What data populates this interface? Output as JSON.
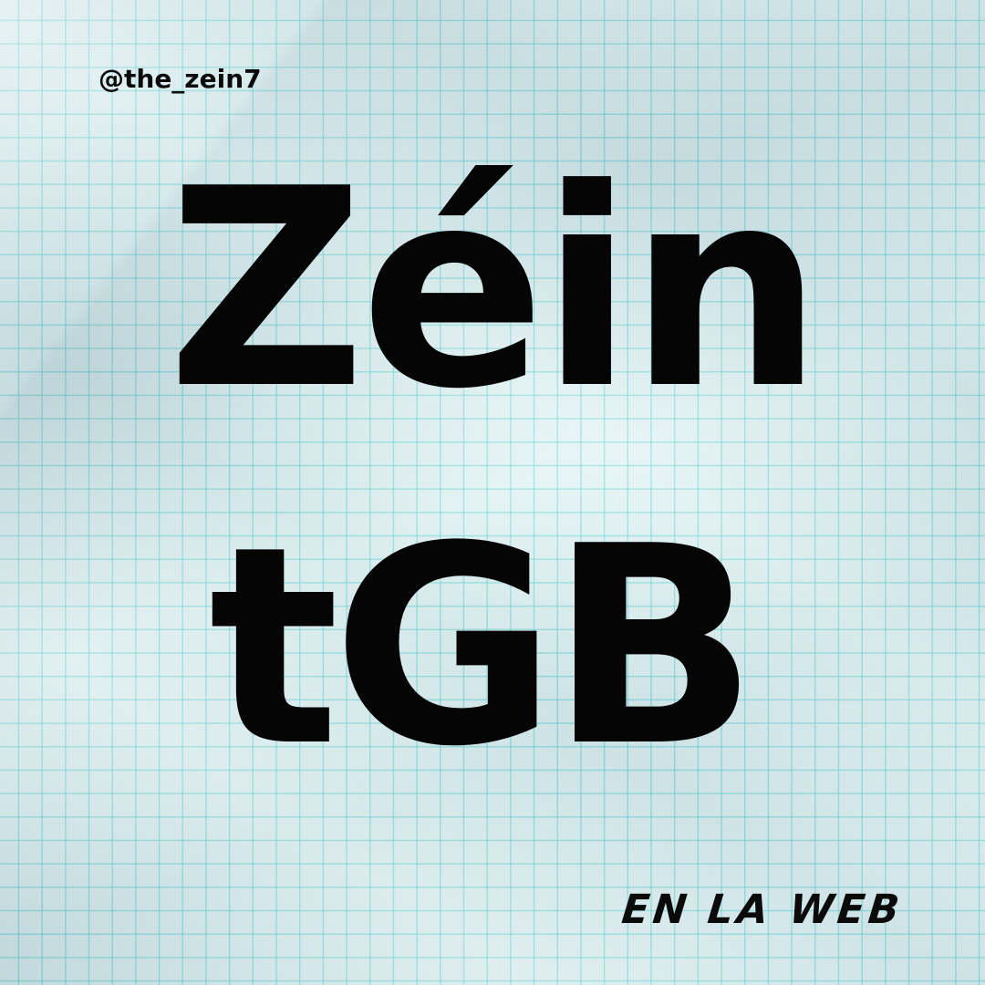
{
  "header": {
    "handle": "@the_zein7"
  },
  "title": {
    "line1": "Zéin",
    "line2": "tGB"
  },
  "footer": {
    "tagline": "EN LA WEB"
  },
  "colors": {
    "text": "#050505",
    "paper": "#dff3f4",
    "grid": "#3ccdcd"
  }
}
